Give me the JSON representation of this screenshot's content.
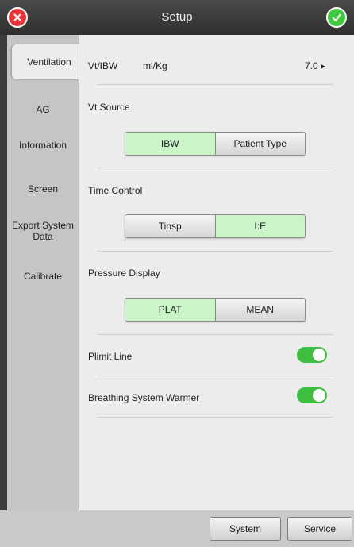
{
  "header": {
    "title": "Setup"
  },
  "sidebar": {
    "items": [
      {
        "label": "Ventilation"
      },
      {
        "label": "AG"
      },
      {
        "label": "Information"
      },
      {
        "label": "Screen"
      },
      {
        "label": "Export System Data"
      },
      {
        "label": "Calibrate"
      }
    ]
  },
  "main": {
    "vt_ibw": {
      "label": "Vt/IBW",
      "unit": "ml/Kg",
      "value": "7.0 ▸"
    },
    "vt_source": {
      "label": "Vt Source",
      "options": [
        "IBW",
        "Patient Type"
      ],
      "selected": "IBW"
    },
    "time_control": {
      "label": "Time Control",
      "options": [
        "Tinsp",
        "I:E"
      ],
      "selected": "I:E"
    },
    "pressure_display": {
      "label": "Pressure Display",
      "options": [
        "PLAT",
        "MEAN"
      ],
      "selected": "PLAT"
    },
    "plimit_line": {
      "label": "Plimit Line",
      "on": true
    },
    "breathing_warmer": {
      "label": "Breathing System Warmer",
      "on": true
    }
  },
  "footer": {
    "system_label": "System",
    "service_label": "Service"
  },
  "colors": {
    "selected_option": "#c9f5c9",
    "toggle_on": "#3fbf3f",
    "close": "#e8353a",
    "ok": "#3ec93e"
  }
}
